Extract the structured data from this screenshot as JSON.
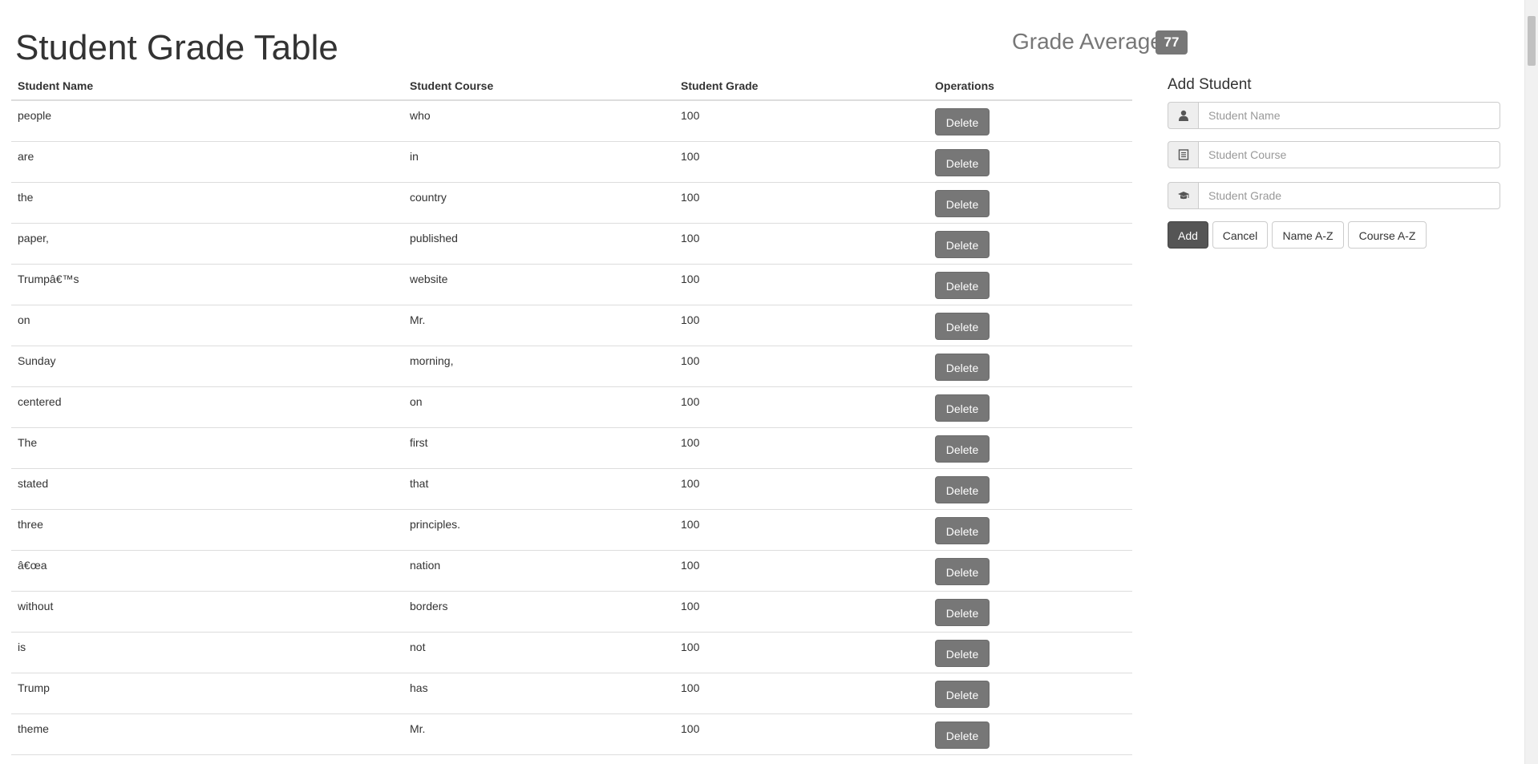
{
  "header": {
    "title": "Student Grade Table",
    "grade_average_label": "Grade Average :",
    "grade_average_value": "77"
  },
  "table": {
    "columns": [
      "Student Name",
      "Student Course",
      "Student Grade",
      "Operations"
    ],
    "delete_label": "Delete",
    "rows": [
      {
        "name": "people",
        "course": "who",
        "grade": "100"
      },
      {
        "name": "are",
        "course": "in",
        "grade": "100"
      },
      {
        "name": "the",
        "course": "country",
        "grade": "100"
      },
      {
        "name": "paper,",
        "course": "published",
        "grade": "100"
      },
      {
        "name": "Trumpâ€™s",
        "course": "website",
        "grade": "100"
      },
      {
        "name": "on",
        "course": "Mr.",
        "grade": "100"
      },
      {
        "name": "Sunday",
        "course": "morning,",
        "grade": "100"
      },
      {
        "name": "centered",
        "course": "on",
        "grade": "100"
      },
      {
        "name": "The",
        "course": "first",
        "grade": "100"
      },
      {
        "name": "stated",
        "course": "that",
        "grade": "100"
      },
      {
        "name": "three",
        "course": "principles.",
        "grade": "100"
      },
      {
        "name": "â€œa",
        "course": "nation",
        "grade": "100"
      },
      {
        "name": "without",
        "course": "borders",
        "grade": "100"
      },
      {
        "name": "is",
        "course": "not",
        "grade": "100"
      },
      {
        "name": "Trump",
        "course": "has",
        "grade": "100"
      },
      {
        "name": "theme",
        "course": "Mr.",
        "grade": "100"
      }
    ]
  },
  "add_panel": {
    "title": "Add Student",
    "name_placeholder": "Student Name",
    "course_placeholder": "Student Course",
    "grade_placeholder": "Student Grade",
    "add_label": "Add",
    "cancel_label": "Cancel",
    "sort_name_label": "Name A-Z",
    "sort_course_label": "Course A-Z",
    "icons": [
      "user-icon",
      "list-icon",
      "graduation-cap-icon"
    ]
  },
  "colors": {
    "badge": "#777777",
    "delete_button": "#777777",
    "add_button": "#555555",
    "text": "#333333"
  }
}
